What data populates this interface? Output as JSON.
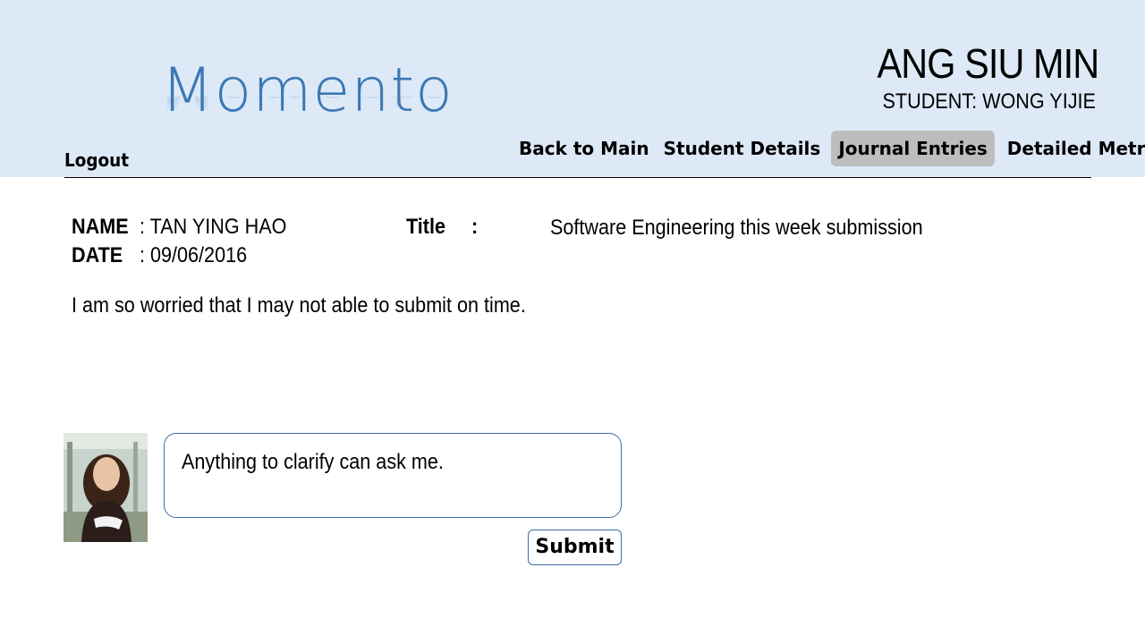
{
  "app": {
    "logo_text": "Momento"
  },
  "header": {
    "user_name": "ANG SIU MIN",
    "student_label": "STUDENT: WONG YIJIE",
    "logout_label": "Logout"
  },
  "nav": {
    "items": [
      {
        "label": "Back to Main"
      },
      {
        "label": "Student Details"
      },
      {
        "label": "Journal Entries",
        "active": true
      },
      {
        "label": "Detailed Metrics"
      }
    ]
  },
  "entry": {
    "name_label": "NAME",
    "name_value": ": TAN YING HAO",
    "date_label": "DATE",
    "date_value": ": 09/06/2016",
    "title_label": "Title",
    "title_colon": ":",
    "title_value": "Software Engineering this week submission",
    "body": "I am so worried that I may not able to submit on time."
  },
  "comment": {
    "avatar_icon": "user-avatar-photo",
    "text": "Anything to clarify can ask me.",
    "submit_label": "Submit"
  },
  "colors": {
    "header_bg": "#dde9f6",
    "logo": "#3c78b5",
    "active_tab": "#bdbdbd",
    "input_border": "#3c6fa8"
  }
}
